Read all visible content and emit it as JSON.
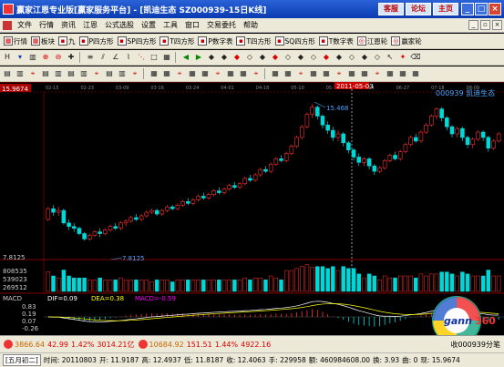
{
  "window": {
    "title": "赢家江恩专业版[赢家服务平台] - [凯迪生态  SZ000939-15日K线]",
    "top_buttons": [
      "客服",
      "论坛",
      "主页"
    ],
    "controls": [
      "_",
      "□",
      "×"
    ]
  },
  "menu": [
    "文件",
    "行情",
    "资讯",
    "江恩",
    "公式选股",
    "设置",
    "工具",
    "窗口",
    "交易委托",
    "帮助"
  ],
  "toolbar1": [
    {
      "icon": "grid-icon",
      "label": "行情"
    },
    {
      "icon": "grid-icon",
      "label": "板块"
    },
    {
      "icon": "box-icon",
      "label": "九"
    },
    {
      "icon": "box-icon",
      "label": "P四方形"
    },
    {
      "icon": "box-icon",
      "label": "SP四方形"
    },
    {
      "icon": "box-icon",
      "label": "T四方形"
    },
    {
      "icon": "box-icon",
      "label": "P数字表"
    },
    {
      "icon": "box-icon",
      "label": "T四方形"
    },
    {
      "icon": "box-icon",
      "label": "SQ四方形"
    },
    {
      "icon": "box-icon",
      "label": "T数字表"
    },
    {
      "icon": "wheel-icon",
      "label": "江恩轮"
    },
    {
      "icon": "wheel-icon",
      "label": "赢家轮"
    }
  ],
  "chart": {
    "price_label": "15.9674",
    "date_cursor_label": "2011-05-03",
    "stock_label": "000939 凯迪生态",
    "x_dates": [
      "02-15",
      "02-23",
      "03-09",
      "03-16",
      "03-24",
      "04-01",
      "04-18",
      "05-10",
      "05-17",
      "06-14",
      "06-27",
      "07-18",
      "08-09"
    ],
    "high_label": "15.468",
    "low_label": "7.8125",
    "left_price": "7.8125",
    "volume_labels": [
      "808535",
      "539023",
      "269512"
    ],
    "macd_title": "MACD",
    "macd_values": {
      "dif": "DIF=0.09",
      "dea": "DEA=0.38",
      "macd": "MACD=-0.59"
    },
    "macd_axis": [
      "0.83",
      "0.19",
      "0.07",
      "-0.26"
    ]
  },
  "chart_data": {
    "type": "candlestick",
    "title": "凯迪生态",
    "candles": [
      [
        9.0,
        9.6,
        9.7,
        8.9
      ],
      [
        9.6,
        9.4,
        9.8,
        9.2
      ],
      [
        9.4,
        9.5,
        9.7,
        9.2
      ],
      [
        9.5,
        8.8,
        9.6,
        8.7
      ],
      [
        8.8,
        8.6,
        9.0,
        8.4
      ],
      [
        8.6,
        8.5,
        8.8,
        8.3
      ],
      [
        8.5,
        8.2,
        8.6,
        8.1
      ],
      [
        8.2,
        7.9,
        8.3,
        7.8
      ],
      [
        7.9,
        8.1,
        8.2,
        7.8
      ],
      [
        8.1,
        8.3,
        8.4,
        8.0
      ],
      [
        8.3,
        8.2,
        8.5,
        8.0
      ],
      [
        8.2,
        8.4,
        8.5,
        8.1
      ],
      [
        8.4,
        8.6,
        8.7,
        8.3
      ],
      [
        8.6,
        8.5,
        8.8,
        8.4
      ],
      [
        8.5,
        8.8,
        8.9,
        8.4
      ],
      [
        8.8,
        8.9,
        9.0,
        8.6
      ],
      [
        8.9,
        9.1,
        9.2,
        8.8
      ],
      [
        9.1,
        9.0,
        9.3,
        8.9
      ],
      [
        9.0,
        9.2,
        9.3,
        8.9
      ],
      [
        9.2,
        9.4,
        9.5,
        9.1
      ],
      [
        9.4,
        9.5,
        9.6,
        9.3
      ],
      [
        9.5,
        9.3,
        9.6,
        9.2
      ],
      [
        9.3,
        9.5,
        9.6,
        9.2
      ],
      [
        9.5,
        9.7,
        9.8,
        9.4
      ],
      [
        9.7,
        9.6,
        9.8,
        9.5
      ],
      [
        9.6,
        9.8,
        9.9,
        9.5
      ],
      [
        9.8,
        10.0,
        10.1,
        9.7
      ],
      [
        10.0,
        9.9,
        10.2,
        9.8
      ],
      [
        9.9,
        10.1,
        10.2,
        9.8
      ],
      [
        10.1,
        10.3,
        10.4,
        10.0
      ],
      [
        10.3,
        10.2,
        10.5,
        10.1
      ],
      [
        10.2,
        10.4,
        10.5,
        10.1
      ],
      [
        10.4,
        10.6,
        10.7,
        10.3
      ],
      [
        10.6,
        10.5,
        10.8,
        10.4
      ],
      [
        10.5,
        10.7,
        10.8,
        10.4
      ],
      [
        10.7,
        10.9,
        11.0,
        10.6
      ],
      [
        10.9,
        10.8,
        11.1,
        10.7
      ],
      [
        10.8,
        11.0,
        11.1,
        10.7
      ],
      [
        11.0,
        11.3,
        11.4,
        10.9
      ],
      [
        11.3,
        11.2,
        11.5,
        11.1
      ],
      [
        11.2,
        11.5,
        11.6,
        11.1
      ],
      [
        11.5,
        11.8,
        11.9,
        11.4
      ],
      [
        11.8,
        11.7,
        12.0,
        11.6
      ],
      [
        11.7,
        12.1,
        12.2,
        11.6
      ],
      [
        12.1,
        12.4,
        12.5,
        12.0
      ],
      [
        12.4,
        12.3,
        12.6,
        12.2
      ],
      [
        12.3,
        12.7,
        12.8,
        12.2
      ],
      [
        12.7,
        13.1,
        13.2,
        12.6
      ],
      [
        13.1,
        13.6,
        13.7,
        13.0
      ],
      [
        13.6,
        14.2,
        14.3,
        13.5
      ],
      [
        14.2,
        14.9,
        15.0,
        14.1
      ],
      [
        14.9,
        15.3,
        15.47,
        14.7
      ],
      [
        15.3,
        14.8,
        15.4,
        14.6
      ],
      [
        14.8,
        14.3,
        14.9,
        14.1
      ],
      [
        14.3,
        14.0,
        14.5,
        13.8
      ],
      [
        14.0,
        13.6,
        14.2,
        13.4
      ],
      [
        13.6,
        13.8,
        14.0,
        13.4
      ],
      [
        13.8,
        13.3,
        13.9,
        13.1
      ],
      [
        13.3,
        12.9,
        13.4,
        12.7
      ],
      [
        12.9,
        12.5,
        13.0,
        12.3
      ],
      [
        12.5,
        12.2,
        12.7,
        12.0
      ],
      [
        12.2,
        12.4,
        12.5,
        12.0
      ],
      [
        12.4,
        12.0,
        12.5,
        11.8
      ],
      [
        12.0,
        11.7,
        12.1,
        11.5
      ],
      [
        11.7,
        11.9,
        12.0,
        11.6
      ],
      [
        11.9,
        12.3,
        12.4,
        11.8
      ],
      [
        12.3,
        12.6,
        12.7,
        12.2
      ],
      [
        12.6,
        12.4,
        12.8,
        12.3
      ],
      [
        12.4,
        12.8,
        12.9,
        12.3
      ],
      [
        12.8,
        13.2,
        13.3,
        12.7
      ],
      [
        13.2,
        13.6,
        13.7,
        13.1
      ],
      [
        13.6,
        13.4,
        13.8,
        13.3
      ],
      [
        13.4,
        13.9,
        14.0,
        13.3
      ],
      [
        13.9,
        14.3,
        14.4,
        13.8
      ],
      [
        14.3,
        14.8,
        14.9,
        14.2
      ],
      [
        14.8,
        15.2,
        15.3,
        14.6
      ],
      [
        15.2,
        14.7,
        15.3,
        14.5
      ],
      [
        14.7,
        14.2,
        14.8,
        14.0
      ],
      [
        14.2,
        13.8,
        14.3,
        13.6
      ],
      [
        13.8,
        14.1,
        14.2,
        13.6
      ],
      [
        14.1,
        13.6,
        14.2,
        13.4
      ],
      [
        13.6,
        13.2,
        13.7,
        13.0
      ],
      [
        13.2,
        13.5,
        13.6,
        13.0
      ],
      [
        13.5,
        13.9,
        14.0,
        13.4
      ],
      [
        13.9,
        13.6,
        14.0,
        13.4
      ],
      [
        13.6,
        13.0,
        13.7,
        12.8
      ],
      [
        13.0,
        13.4,
        13.5,
        12.9
      ],
      [
        13.4,
        13.8,
        13.9,
        13.3
      ]
    ],
    "ylim": [
      7.0,
      16.0
    ]
  },
  "indexbar": [
    {
      "value": "3866.64",
      "change": "42.99",
      "pct": "1.42%",
      "amount": "3014.21亿"
    },
    {
      "value": "10684.92",
      "change": "151.51",
      "pct": "1.44%",
      "amount": "4922.16"
    }
  ],
  "indexbar_right": "收000939分笔",
  "status": {
    "period": "[五月初二]",
    "fields": [
      "时间: 20110803",
      "开: 11.9187",
      "高: 12.4937",
      "低: 11.8187",
      "收: 12.4063",
      "手: 229958",
      "额: 460984608.00",
      "换: 3.93",
      "曲: 0",
      "现: 15.9674"
    ]
  }
}
